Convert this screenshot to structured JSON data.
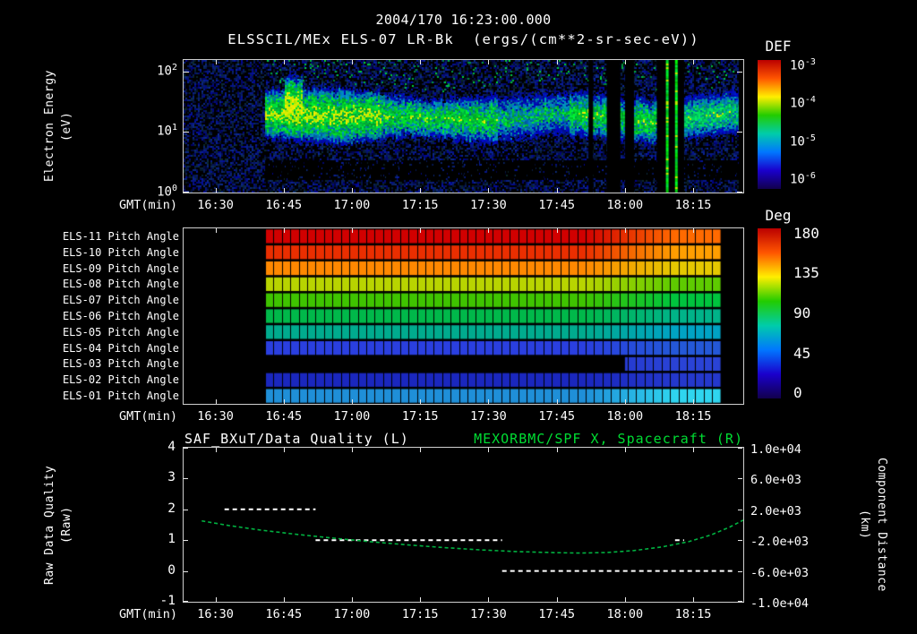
{
  "page": {
    "bg": "#000000",
    "fg": "#ffffff",
    "accent_green": "#00dd33"
  },
  "header": {
    "datetime": "2004/170 16:23:00.000",
    "title": "ELSSCIL/MEx ELS-07 LR-Bk  (ergs/(cm**2-sr-sec-eV))"
  },
  "time_axis": {
    "label": "GMT(min)",
    "start": "16:23",
    "end": "18:26",
    "ticks": [
      "16:30",
      "16:45",
      "17:00",
      "17:15",
      "17:30",
      "17:45",
      "18:00",
      "18:15"
    ]
  },
  "spectrogram_panel": {
    "ylabel": [
      "Electron Energy",
      "(eV)"
    ],
    "yticks": [
      {
        "base": "10",
        "exp": "2",
        "frac": 0.088
      },
      {
        "base": "10",
        "exp": "1",
        "frac": 0.541
      },
      {
        "base": "10",
        "exp": "0",
        "frac": 1.0
      }
    ],
    "colorbar": {
      "title": "DEF",
      "stops": [
        "#bb0000",
        "#ff5500",
        "#ffee00",
        "#22cc00",
        "#00ccaa",
        "#0077ff",
        "#1a00cc",
        "#12004d"
      ],
      "ticks": [
        {
          "base": "10",
          "exp": "-3",
          "frac": 0.045
        },
        {
          "base": "10",
          "exp": "-4",
          "frac": 0.335
        },
        {
          "base": "10",
          "exp": "-5",
          "frac": 0.63
        },
        {
          "base": "10",
          "exp": "-6",
          "frac": 0.925
        }
      ]
    }
  },
  "pitch_panel": {
    "data_start": "16:41",
    "data_end": "18:21",
    "rows": [
      {
        "label": "ELS-11 Pitch Angle",
        "main": "#d10000",
        "end": "#ff6a00"
      },
      {
        "label": "ELS-10 Pitch Angle",
        "main": "#ea2e00",
        "end": "#ff9e00"
      },
      {
        "label": "ELS-09 Pitch Angle",
        "main": "#ff8800",
        "end": "#e5c800"
      },
      {
        "label": "ELS-08 Pitch Angle",
        "main": "#b8d400",
        "end": "#5ecb00"
      },
      {
        "label": "ELS-07 Pitch Angle",
        "main": "#3fc400",
        "end": "#00c43e"
      },
      {
        "label": "ELS-06 Pitch Angle",
        "main": "#00b84a",
        "end": "#00b389"
      },
      {
        "label": "ELS-05 Pitch Angle",
        "main": "#00ab8e",
        "end": "#00a3c4"
      },
      {
        "label": "ELS-04 Pitch Angle",
        "main": "#2a3fe0",
        "end": "#2458d8"
      },
      {
        "label": "ELS-03 Pitch Angle",
        "main": "#2334cc",
        "end": "#2a43d6",
        "black_until": "18:00"
      },
      {
        "label": "ELS-02 Pitch Angle",
        "main": "#1a27be",
        "end": "#2438cc"
      },
      {
        "label": "ELS-01 Pitch Angle",
        "main": "#1f8fd8",
        "end": "#2fd5ef"
      }
    ],
    "colorbar": {
      "title": "Deg",
      "stops": [
        "#bb0000",
        "#ff5500",
        "#ffee00",
        "#22cc00",
        "#00ccaa",
        "#0077ff",
        "#1a00cc",
        "#12004d"
      ],
      "ticks": [
        {
          "t": "180",
          "frac": 0.03
        },
        {
          "t": "135",
          "frac": 0.265
        },
        {
          "t": "90",
          "frac": 0.5
        },
        {
          "t": "45",
          "frac": 0.735
        },
        {
          "t": "0",
          "frac": 0.97
        }
      ]
    }
  },
  "lineplot_panel": {
    "title_left": "SAF_BXuT/Data Quality (L)",
    "title_right": "MEXORBMC/SPF X, Spacecraft (R)",
    "title_right_color": "#00dd33",
    "ylabel_left": [
      "Raw Data Quality",
      "(Raw)"
    ],
    "ylabel_right": [
      "Component Distance",
      "(km)"
    ],
    "yticks_left": [
      "4",
      "3",
      "2",
      "1",
      "0",
      "-1"
    ],
    "yticks_right": [
      "1.0e+04",
      "6.0e+03",
      "2.0e+03",
      "-2.0e+03",
      "-6.0e+03",
      "-1.0e+04"
    ],
    "ylim_left": [
      -1,
      4
    ],
    "ylim_right": [
      -10000,
      10000
    ]
  },
  "chart_data": [
    {
      "type": "heatmap",
      "name": "energy_spectrogram",
      "title": "ELSSCIL/MEx ELS-07 LR-Bk",
      "units": "ergs/(cm**2-sr-sec-eV)",
      "xlabel": "GMT(min)",
      "ylabel": "Electron Energy (eV)",
      "x_range": [
        "16:23",
        "18:26"
      ],
      "y_scale": "log",
      "y_range_eV": [
        1,
        155
      ],
      "z_scale": "log",
      "z_range": [
        1e-06,
        0.001
      ],
      "data_start": "16:41",
      "main_band": {
        "energy_eV": [
          6,
          60
        ],
        "time": [
          "16:41",
          "18:25"
        ],
        "flux": "~1e-4 (green)"
      },
      "burst": {
        "time": [
          "16:45",
          "16:49"
        ],
        "energy_eV": [
          10,
          90
        ],
        "flux": "~3e-4 (yellow-green)"
      },
      "dim_interval": [
        "17:32",
        "17:48"
      ],
      "gaps": [
        [
          "17:52",
          "17:53"
        ],
        [
          "17:56",
          "17:59"
        ],
        [
          "18:00",
          "18:02"
        ],
        [
          "18:07",
          "18:13"
        ]
      ],
      "spikes": [
        "18:09",
        "18:11"
      ],
      "background_flux": "~1e-6 (dark blue/black speckle)"
    },
    {
      "type": "heatmap",
      "name": "pitch_angles",
      "ylabel": "Deg",
      "y_range": [
        0,
        180
      ],
      "time_range": [
        "16:41",
        "18:21"
      ],
      "rows": [
        {
          "sensor": "ELS-11",
          "angle_deg_start": 170,
          "angle_deg_end": 140
        },
        {
          "sensor": "ELS-10",
          "angle_deg_start": 158,
          "angle_deg_end": 128
        },
        {
          "sensor": "ELS-09",
          "angle_deg_start": 140,
          "angle_deg_end": 114
        },
        {
          "sensor": "ELS-08",
          "angle_deg_start": 118,
          "angle_deg_end": 100
        },
        {
          "sensor": "ELS-07",
          "angle_deg_start": 101,
          "angle_deg_end": 88
        },
        {
          "sensor": "ELS-06",
          "angle_deg_start": 88,
          "angle_deg_end": 76
        },
        {
          "sensor": "ELS-05",
          "angle_deg_start": 74,
          "angle_deg_end": 61
        },
        {
          "sensor": "ELS-04",
          "angle_deg_start": 40,
          "angle_deg_end": 48
        },
        {
          "sensor": "ELS-03",
          "angle_deg_start": null,
          "angle_deg_end": 33,
          "note": "no data before 18:00"
        },
        {
          "sensor": "ELS-02",
          "angle_deg_start": 27,
          "angle_deg_end": 33
        },
        {
          "sensor": "ELS-01",
          "angle_deg_start": 55,
          "angle_deg_end": 68
        }
      ]
    },
    {
      "type": "line",
      "name": "quality_and_distance",
      "x_range": [
        "16:23",
        "18:26"
      ],
      "ylim_left": [
        -1,
        4
      ],
      "ylim_right": [
        -10000,
        10000
      ],
      "series": [
        {
          "name": "SAF_BXuT/Data Quality (L)",
          "axis": "left",
          "color": "#ffffff",
          "style": "dashed",
          "segments": [
            {
              "value": 2,
              "from": "16:32",
              "to": "16:52"
            },
            {
              "value": 1,
              "from": "16:52",
              "to": "17:33"
            },
            {
              "value": 0,
              "from": "17:33",
              "to": "18:24"
            },
            {
              "value": 1,
              "from": "18:11",
              "to": "18:13"
            }
          ]
        },
        {
          "name": "MEXORBMC/SPF X, Spacecraft (R)",
          "axis": "right",
          "color": "#00b140",
          "style": "dashed",
          "points": [
            [
              "16:27",
              500
            ],
            [
              "16:33",
              -100
            ],
            [
              "16:40",
              -700
            ],
            [
              "16:48",
              -1250
            ],
            [
              "16:56",
              -1750
            ],
            [
              "17:04",
              -2200
            ],
            [
              "17:12",
              -2600
            ],
            [
              "17:20",
              -2950
            ],
            [
              "17:28",
              -3250
            ],
            [
              "17:36",
              -3480
            ],
            [
              "17:44",
              -3620
            ],
            [
              "17:50",
              -3670
            ],
            [
              "17:56",
              -3600
            ],
            [
              "18:02",
              -3350
            ],
            [
              "18:08",
              -2900
            ],
            [
              "18:14",
              -2200
            ],
            [
              "18:19",
              -1300
            ],
            [
              "18:23",
              -300
            ],
            [
              "18:26",
              600
            ]
          ]
        }
      ]
    }
  ]
}
